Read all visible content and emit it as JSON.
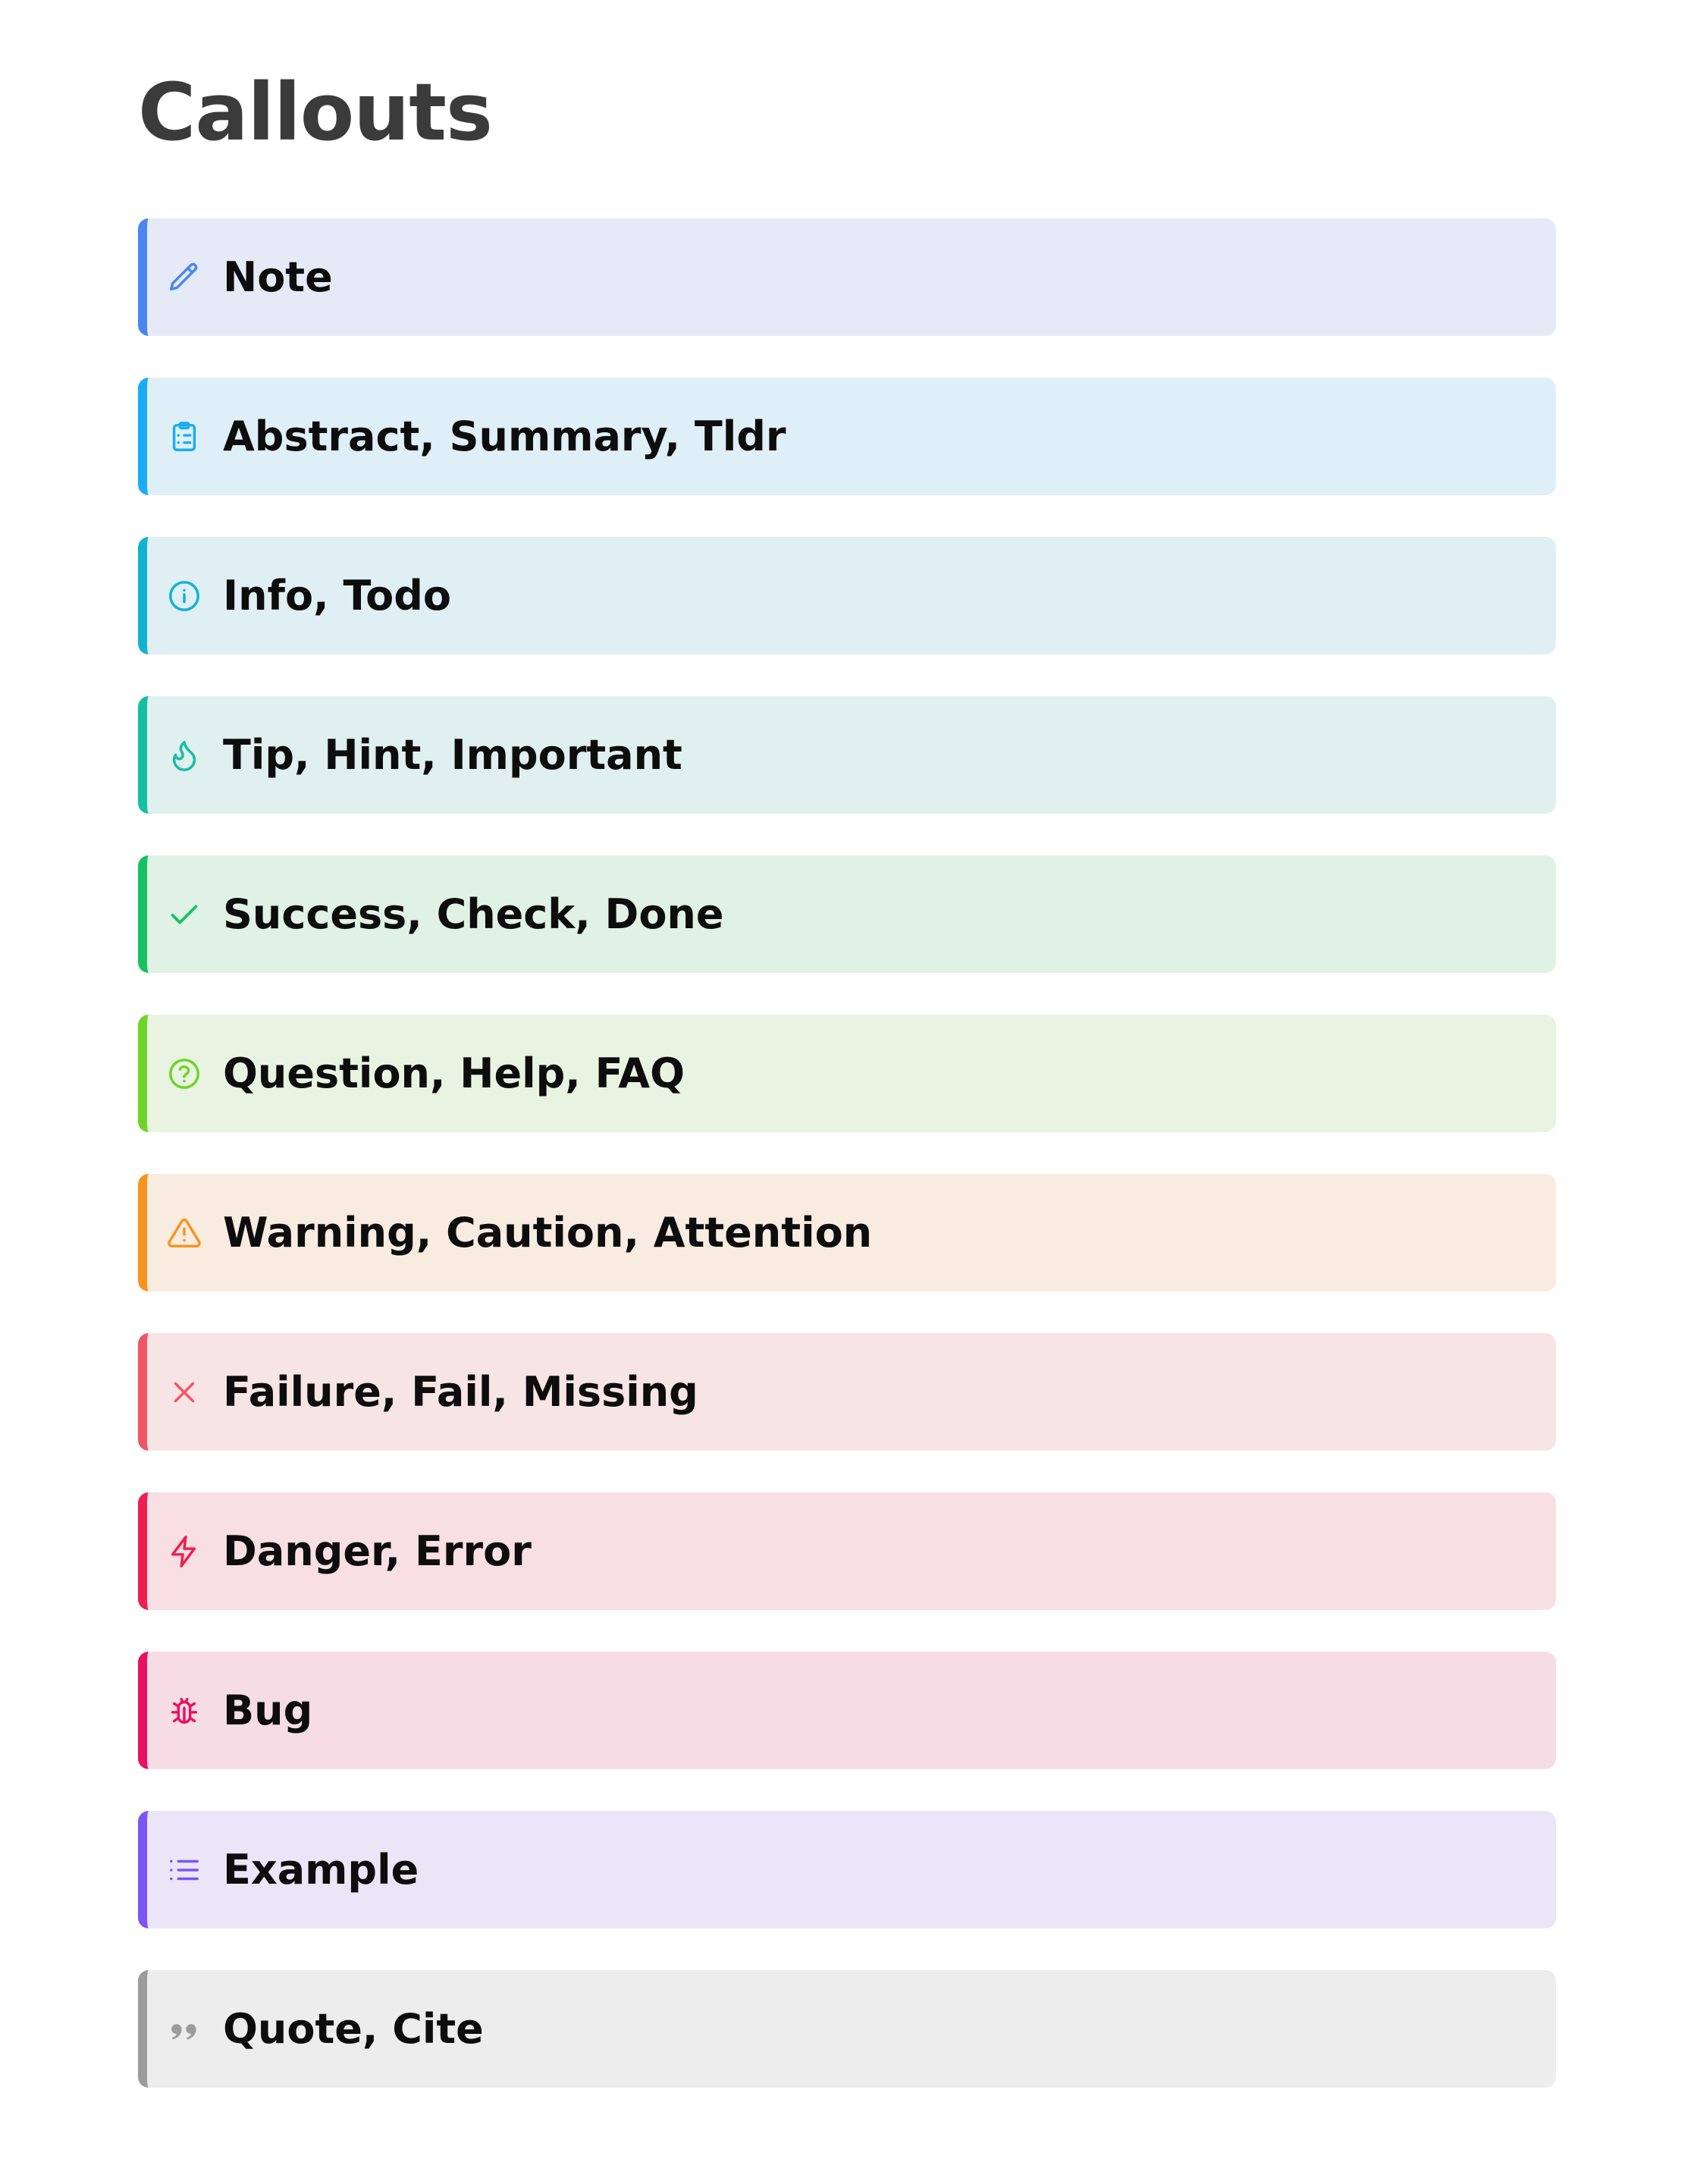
{
  "page": {
    "title": "Callouts"
  },
  "callouts": [
    {
      "label": "Note",
      "icon": "pencil-icon",
      "accent": "#4a86f0",
      "bg": "#e5eaf6"
    },
    {
      "label": "Abstract, Summary, Tldr",
      "icon": "clipboard-list-icon",
      "accent": "#18adf2",
      "bg": "#dfeff7"
    },
    {
      "label": "Info, Todo",
      "icon": "info-circle-icon",
      "accent": "#12b3d0",
      "bg": "#dfeff4"
    },
    {
      "label": "Tip, Hint, Important",
      "icon": "flame-icon",
      "accent": "#14bfa4",
      "bg": "#dff0ee"
    },
    {
      "label": "Success, Check, Done",
      "icon": "check-icon",
      "accent": "#15c261",
      "bg": "#e0f2e6"
    },
    {
      "label": "Question, Help, FAQ",
      "icon": "help-circle-icon",
      "accent": "#70d32a",
      "bg": "#e8f4e1"
    },
    {
      "label": "Warning, Caution, Attention",
      "icon": "alert-triangle-icon",
      "accent": "#f7941d",
      "bg": "#f8ece1"
    },
    {
      "label": "Failure, Fail, Missing",
      "icon": "x-icon",
      "accent": "#f25563",
      "bg": "#f7e5e5"
    },
    {
      "label": "Danger, Error",
      "icon": "zap-icon",
      "accent": "#ee1f4e",
      "bg": "#f7dfe3"
    },
    {
      "label": "Bug",
      "icon": "bug-icon",
      "accent": "#ea1061",
      "bg": "#f6dde5"
    },
    {
      "label": "Example",
      "icon": "list-icon",
      "accent": "#7c55f4",
      "bg": "#eae6f7"
    },
    {
      "label": "Quote, Cite",
      "icon": "quote-icon",
      "accent": "#9b9b9b",
      "bg": "#ededed"
    }
  ]
}
